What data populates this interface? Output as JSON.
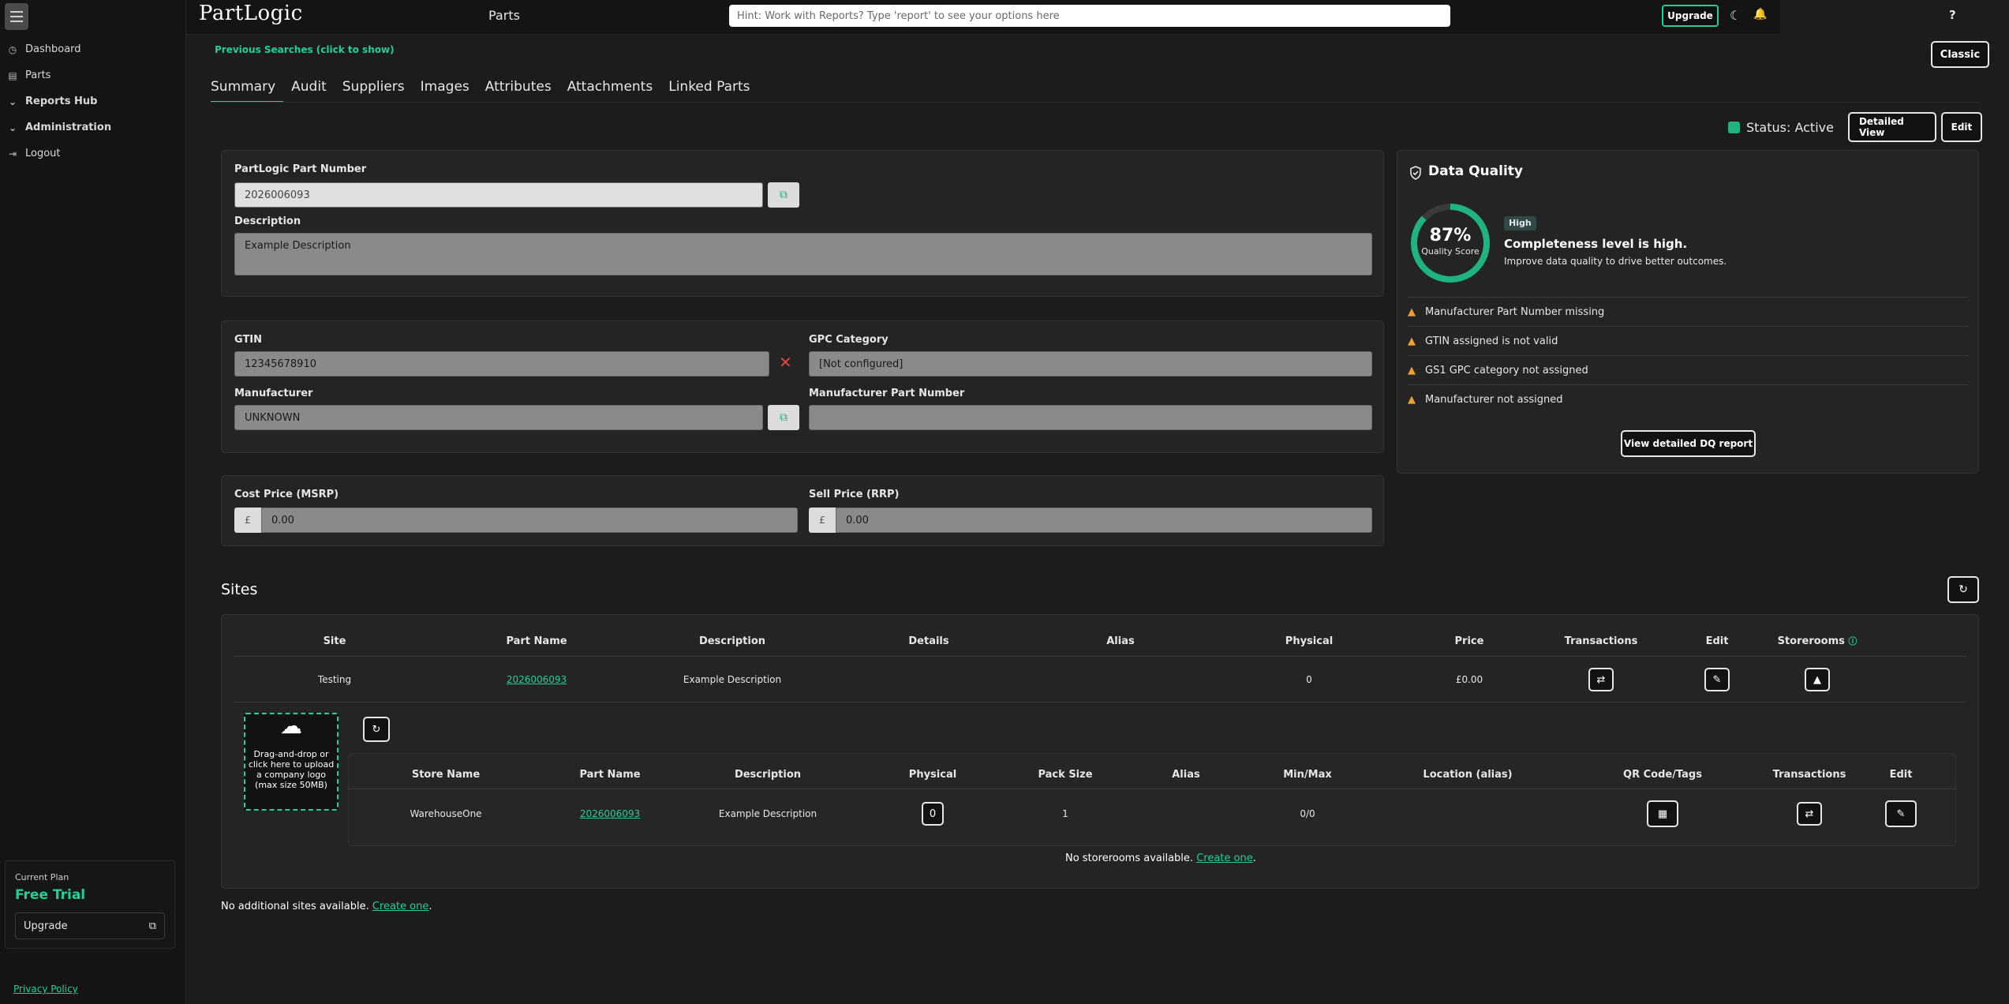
{
  "app": {
    "logo": "PartLogic",
    "section_title": "Parts"
  },
  "search": {
    "placeholder": "Hint: Work with Reports? Type 'report' to see your options here"
  },
  "topbar": {
    "upgrade_label": "Upgrade",
    "help_label": "?"
  },
  "sidebar": {
    "items": [
      {
        "label": "Dashboard",
        "icon": "dashboard-icon"
      },
      {
        "label": "Parts",
        "icon": "parts-icon"
      },
      {
        "label": "Reports Hub",
        "icon": "chevron-down-icon"
      },
      {
        "label": "Administration",
        "icon": "chevron-down-icon"
      },
      {
        "label": "Logout",
        "icon": "logout-icon"
      }
    ],
    "plan_label": "Current Plan",
    "plan_name": "Free Trial",
    "upgrade_label": "Upgrade",
    "privacy_label": "Privacy Policy"
  },
  "main": {
    "previous_searches": "Previous Searches (click to show)",
    "classic_label": "Classic",
    "tabs": [
      "Summary",
      "Audit",
      "Suppliers",
      "Images",
      "Attributes",
      "Attachments",
      "Linked Parts"
    ],
    "status_text": "Status: Active",
    "detailed_view_label": "Detailed View",
    "edit_label": "Edit"
  },
  "part": {
    "part_number_label": "PartLogic Part Number",
    "part_number": "2026006093",
    "description_label": "Description",
    "description": "Example Description",
    "gtin_label": "GTIN",
    "gtin": "12345678910",
    "gpc_label": "GPC Category",
    "gpc": "[Not configured]",
    "manufacturer_label": "Manufacturer",
    "manufacturer": "UNKNOWN",
    "mpn_label": "Manufacturer Part Number",
    "mpn": "",
    "cost_label": "Cost Price (MSRP)",
    "cost": "0.00",
    "sell_label": "Sell Price (RRP)",
    "sell": "0.00",
    "currency": "£"
  },
  "data_quality": {
    "title": "Data Quality",
    "score_text": "87%",
    "score": 0.87,
    "score_label": "Quality Score",
    "badge": "High",
    "headline": "Completeness level is high.",
    "sub": "Improve data quality to drive better outcomes.",
    "issues": [
      "Manufacturer Part Number missing",
      "GTIN assigned is not valid",
      "GS1 GPC category not assigned",
      "Manufacturer not assigned"
    ],
    "report_button": "View detailed DQ report",
    "accent_color": "#1fb380"
  },
  "sites": {
    "title": "Sites",
    "headers": [
      "Site",
      "Part Name",
      "Description",
      "Details",
      "Alias",
      "Physical",
      "Price",
      "Transactions",
      "Edit",
      "Storerooms"
    ],
    "rows": [
      {
        "site": "Testing",
        "part_name": "2026006093",
        "description": "Example Description",
        "details": "",
        "alias": "",
        "physical": "0",
        "price": "£0.00"
      }
    ],
    "upload_text": "Drag-and-drop or click here to upload a company logo (max size 50MB)",
    "store_headers": [
      "Store Name",
      "Part Name",
      "Description",
      "Physical",
      "Pack Size",
      "Alias",
      "Min/Max",
      "Location (alias)",
      "QR Code/Tags",
      "Transactions",
      "Edit"
    ],
    "store_rows": [
      {
        "store_name": "WarehouseOne",
        "part_name": "2026006093",
        "description": "Example Description",
        "physical": "0",
        "pack_size": "1",
        "alias": "",
        "minmax": "0/0",
        "location": ""
      }
    ],
    "no_storerooms": "No storerooms available.",
    "create_one": "Create one",
    "no_sites": "No additional sites available.",
    "period": "."
  }
}
